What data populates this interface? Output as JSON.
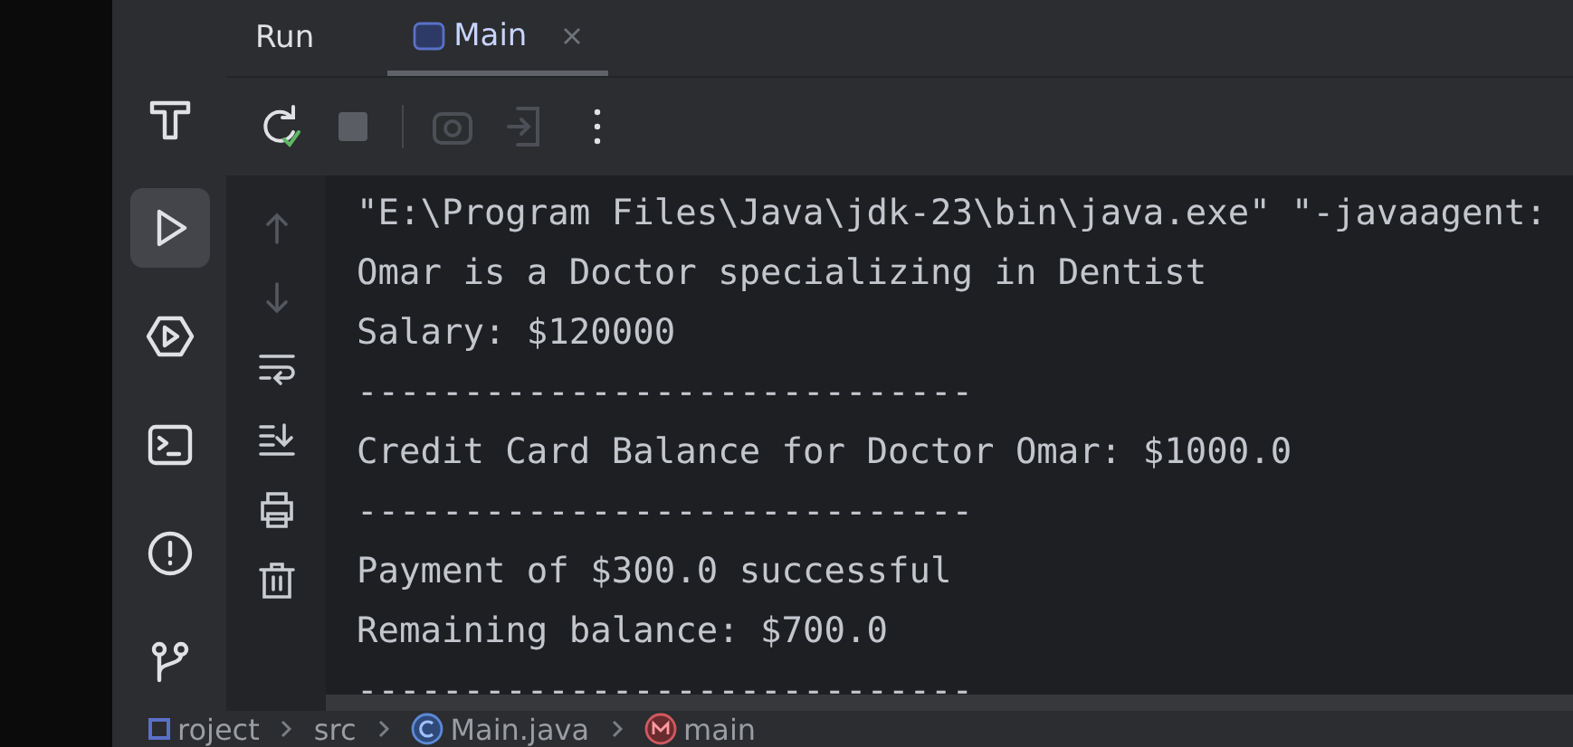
{
  "tool_window": {
    "title": "Run",
    "tabs": [
      {
        "label": "Main",
        "selected": true
      }
    ]
  },
  "left_toolbar": [
    {
      "kind": "build",
      "selected": false
    },
    {
      "kind": "run",
      "selected": true
    },
    {
      "kind": "services",
      "selected": false
    },
    {
      "kind": "terminal",
      "selected": false
    },
    {
      "kind": "problems",
      "selected": false
    },
    {
      "kind": "git",
      "selected": false
    }
  ],
  "run_toolbar": [
    {
      "kind": "rerun"
    },
    {
      "kind": "stop",
      "disabled": true
    },
    {
      "kind": "divider"
    },
    {
      "kind": "camera",
      "disabled": true
    },
    {
      "kind": "exit",
      "disabled": true
    },
    {
      "kind": "more"
    }
  ],
  "console_toolbar": [
    {
      "kind": "up",
      "disabled": true
    },
    {
      "kind": "down",
      "disabled": true
    },
    {
      "kind": "wrap",
      "disabled": false
    },
    {
      "kind": "scroll-end",
      "disabled": false
    },
    {
      "kind": "print",
      "disabled": false
    },
    {
      "kind": "trash",
      "disabled": false
    }
  ],
  "console": {
    "lines": [
      "\"E:\\Program Files\\Java\\jdk-23\\bin\\java.exe\" \"-javaagent:",
      "Omar is a Doctor specializing in Dentist",
      "Salary: $120000",
      "-----------------------------",
      "Credit Card Balance for Doctor Omar: $1000.0",
      "-----------------------------",
      "Payment of $300.0 successful",
      "Remaining balance: $700.0",
      "-----------------------------"
    ]
  },
  "breadcrumb": [
    {
      "kind": "module",
      "label": "roject"
    },
    {
      "kind": "folder",
      "label": "src"
    },
    {
      "kind": "class",
      "label": "Main.java"
    },
    {
      "kind": "method",
      "label": "main"
    }
  ]
}
